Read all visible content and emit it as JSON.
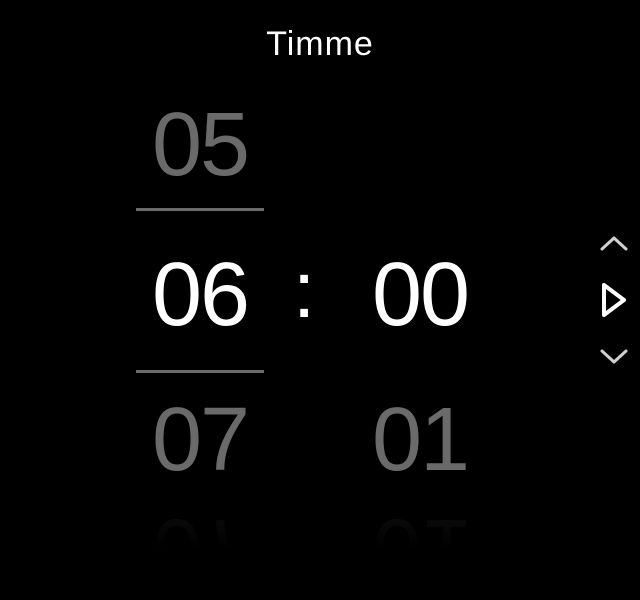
{
  "title": "Timme",
  "hour": {
    "prev": "05",
    "current": "06",
    "next": "07"
  },
  "minute": {
    "current": "00",
    "next": "01"
  },
  "separator": ":"
}
